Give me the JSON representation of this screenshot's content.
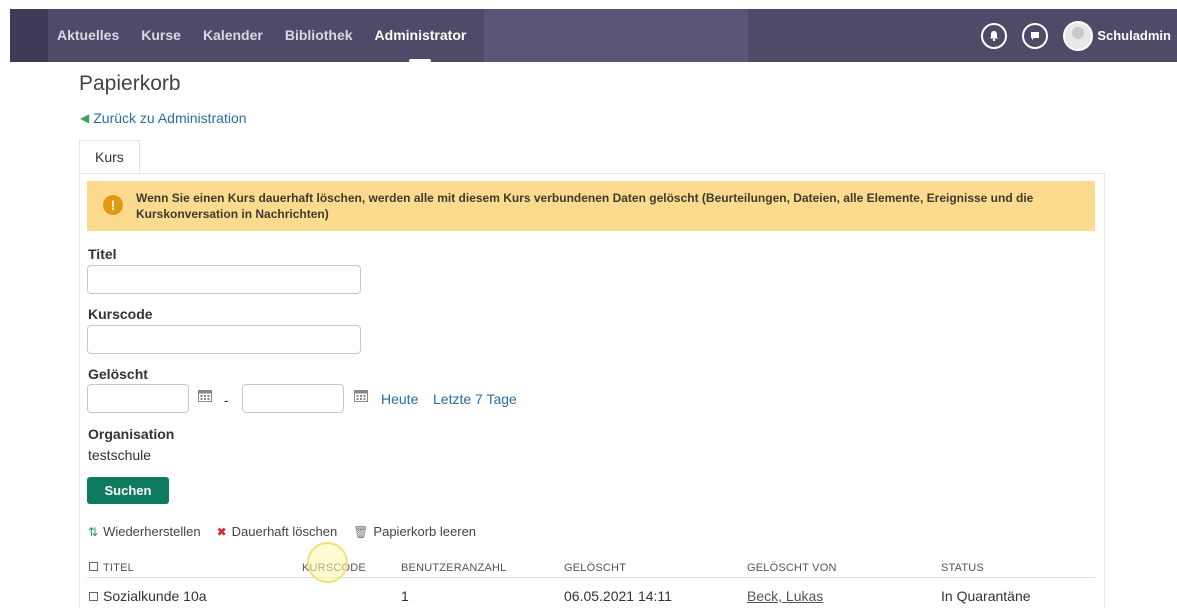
{
  "nav": {
    "items": [
      "Aktuelles",
      "Kurse",
      "Kalender",
      "Bibliothek",
      "Administrator"
    ],
    "active": "Administrator",
    "user": "Schuladmin",
    "icons": [
      "bell-icon",
      "chat-icon"
    ]
  },
  "page": {
    "title": "Papierkorb",
    "back_link": "Zurück zu Administration",
    "tab": "Kurs"
  },
  "alert": {
    "text": "Wenn Sie einen Kurs dauerhaft löschen, werden alle mit diesem Kurs verbundenen Daten gelöscht (Beurteilungen, Dateien, alle Elemente, Ereignisse und die Kurskonversation in Nachrichten)",
    "color": "#fbdc8f"
  },
  "form": {
    "title_label": "Titel",
    "title_value": "",
    "code_label": "Kurscode",
    "code_value": "",
    "deleted_label": "Gelöscht",
    "date_from": "",
    "date_to": "",
    "dash": "-",
    "today": "Heute",
    "last7": "Letzte 7 Tage",
    "org_label": "Organisation",
    "org_value": "testschule",
    "search_button": "Suchen",
    "search_color": "#0f7b5e"
  },
  "actions": {
    "restore": "Wiederherstellen",
    "delete": "Dauerhaft löschen",
    "empty": "Papierkorb leeren"
  },
  "table": {
    "headers": [
      "TITEL",
      "KURSCODE",
      "BENUTZERANZAHL",
      "GELÖSCHT",
      "GELÖSCHT VON",
      "STATUS"
    ],
    "rows": [
      {
        "title": "Sozialkunde 10a",
        "code": "",
        "users": "1",
        "deleted": "06.05.2021 14:11",
        "deleted_by": "Beck, Lukas",
        "status": "In Quarantäne"
      }
    ]
  }
}
